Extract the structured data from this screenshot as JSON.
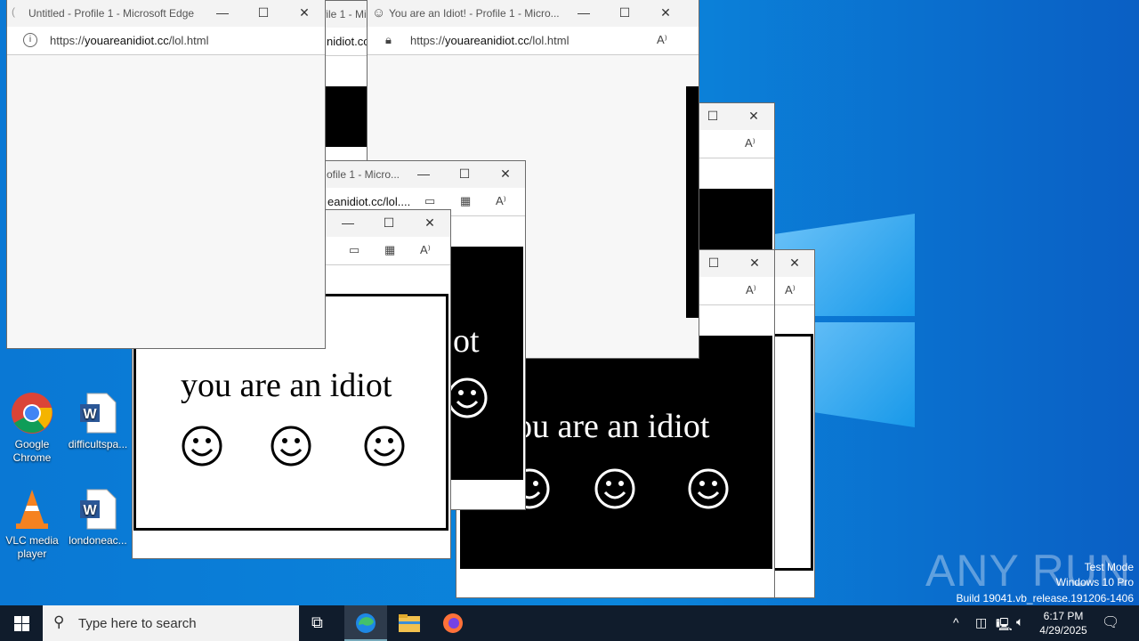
{
  "desktop": {
    "icons": [
      {
        "label": "Google Chrome",
        "icon": "chrome-icon"
      },
      {
        "label": "difficultspa...",
        "icon": "word-doc-icon"
      },
      {
        "label": "VLC media player",
        "icon": "vlc-icon"
      },
      {
        "label": "londoneac...",
        "icon": "word-doc-icon"
      }
    ],
    "watermark": {
      "brand": "ANY RUN",
      "line1": "Test Mode",
      "line2": "Windows 10 Pro",
      "line3": "Build 19041.vb_release.191206-1406"
    }
  },
  "windows": {
    "front": {
      "title": "Untitled - Profile 1 - Microsoft Edge",
      "url_prefix": "https://",
      "url_domain": "youareanidiot.cc",
      "url_path": "/lol.html"
    },
    "top_middle": {
      "title": "You are an Idiot! - Profile 1 - Micro...",
      "url_prefix": "https://",
      "url_domain": "youareanidiot.cc",
      "url_path": "/lol.html"
    },
    "behind_title_fragment": "file 1 - Mi",
    "behind_url_fragment": "nidiot.cc",
    "mid_title": "ofile 1 - Micro...",
    "mid_url": "eanidiot.cc/lol....",
    "page_text": "you are an idiot",
    "page_text_partial_1": "ot",
    "page_text_partial_2": "ou are an idiot",
    "controls": {
      "minimize": "—",
      "maximize": "☐",
      "close": "✕"
    }
  },
  "taskbar": {
    "search_placeholder": "Type here to search",
    "time": "6:17 PM",
    "date": "4/29/2025"
  }
}
